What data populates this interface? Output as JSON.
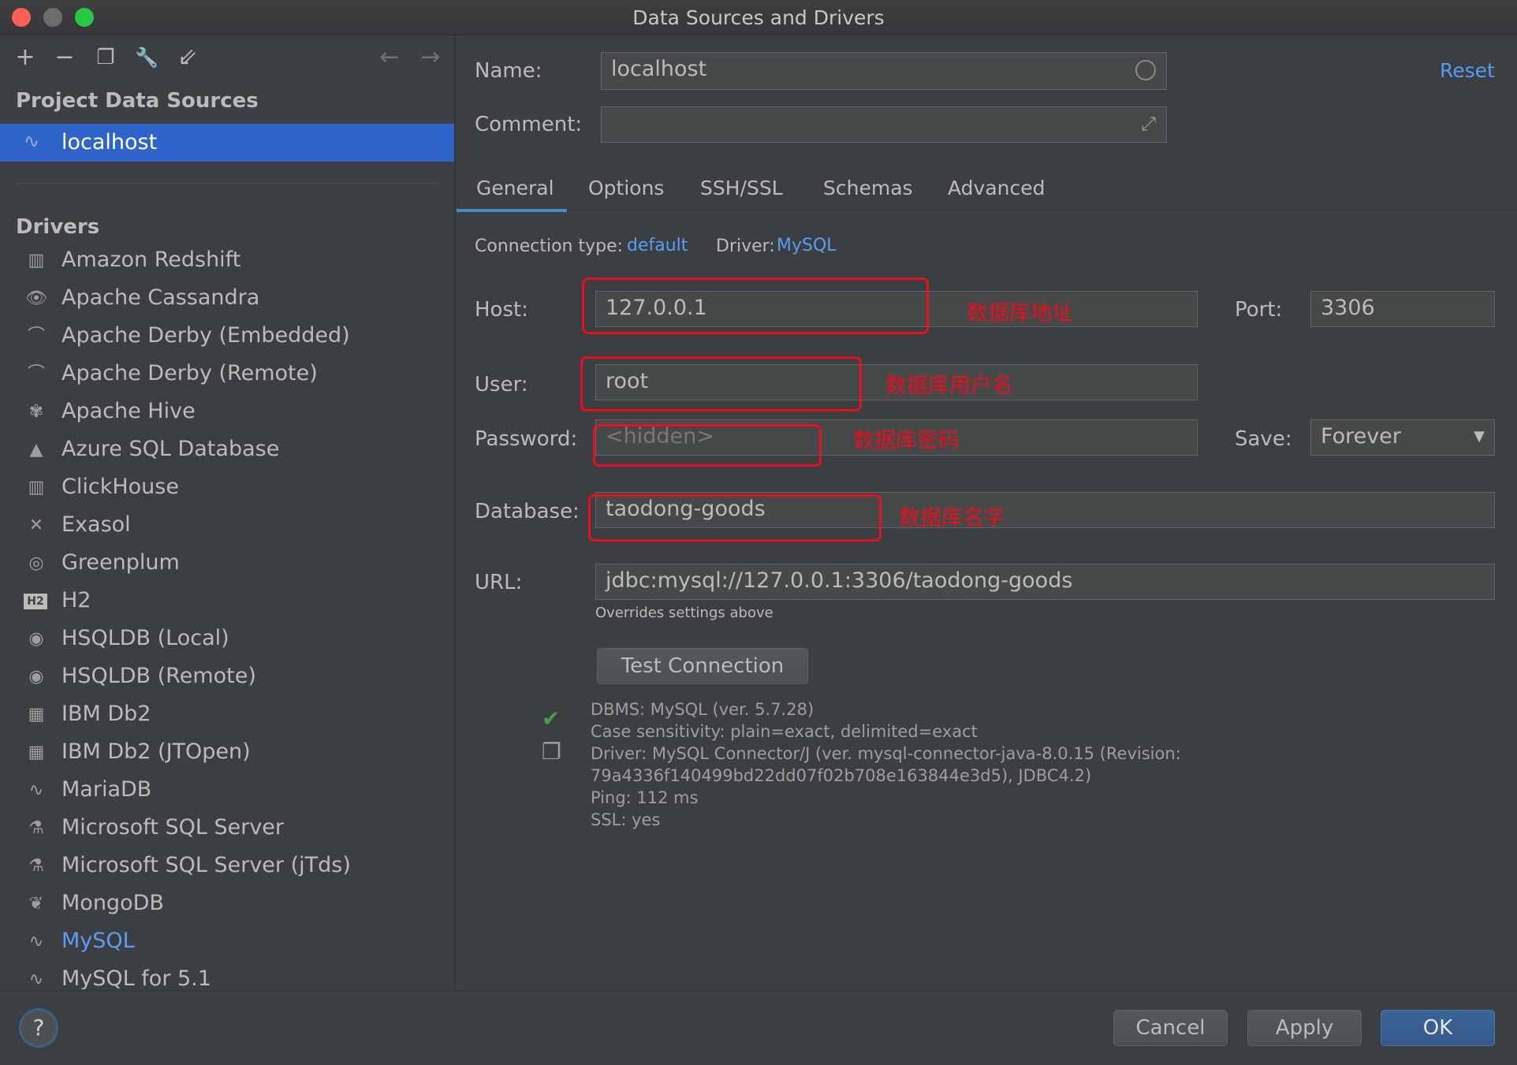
{
  "window": {
    "title": "Data Sources and Drivers"
  },
  "toolbar": {
    "add_icon": "+",
    "remove_icon": "−",
    "duplicate_icon": "❐",
    "settings_icon": "🔧",
    "import_icon": "⇙",
    "back_icon": "←",
    "forward_icon": "→"
  },
  "sidebar": {
    "project_title": "Project Data Sources",
    "data_sources": [
      {
        "label": "localhost"
      }
    ],
    "drivers_title": "Drivers",
    "drivers": [
      {
        "label": "Amazon Redshift",
        "icon": "▥"
      },
      {
        "label": "Apache Cassandra",
        "icon": "👁"
      },
      {
        "label": "Apache Derby (Embedded)",
        "icon": "⌒"
      },
      {
        "label": "Apache Derby (Remote)",
        "icon": "⌒"
      },
      {
        "label": "Apache Hive",
        "icon": "✾"
      },
      {
        "label": "Azure SQL Database",
        "icon": "▲"
      },
      {
        "label": "ClickHouse",
        "icon": "▥"
      },
      {
        "label": "Exasol",
        "icon": "✕"
      },
      {
        "label": "Greenplum",
        "icon": "◎"
      },
      {
        "label": "H2",
        "icon": "H2"
      },
      {
        "label": "HSQLDB (Local)",
        "icon": "◉"
      },
      {
        "label": "HSQLDB (Remote)",
        "icon": "◉"
      },
      {
        "label": "IBM Db2",
        "icon": "▦"
      },
      {
        "label": "IBM Db2 (JTOpen)",
        "icon": "▦"
      },
      {
        "label": "MariaDB",
        "icon": "∿"
      },
      {
        "label": "Microsoft SQL Server",
        "icon": "⚗"
      },
      {
        "label": "Microsoft SQL Server (jTds)",
        "icon": "⚗"
      },
      {
        "label": "MongoDB",
        "icon": "❦"
      },
      {
        "label": "MySQL",
        "icon": "∿"
      },
      {
        "label": "MySQL for 5.1",
        "icon": "∿"
      }
    ]
  },
  "form": {
    "name_label": "Name:",
    "name_value": "localhost",
    "comment_label": "Comment:",
    "comment_value": "",
    "reset_label": "Reset",
    "tabs": [
      "General",
      "Options",
      "SSH/SSL",
      "Schemas",
      "Advanced"
    ],
    "connection_type_label": "Connection type:",
    "connection_type_value": "default",
    "driver_label": "Driver:",
    "driver_value": "MySQL",
    "host_label": "Host:",
    "host_value": "127.0.0.1",
    "port_label": "Port:",
    "port_value": "3306",
    "user_label": "User:",
    "user_value": "root",
    "password_label": "Password:",
    "password_placeholder": "<hidden>",
    "save_label": "Save:",
    "save_value": "Forever",
    "database_label": "Database:",
    "database_value": "taodong-goods",
    "url_label": "URL:",
    "url_value": "jdbc:mysql://127.0.0.1:3306/taodong-goods",
    "url_hint": "Overrides settings above",
    "test_button": "Test Connection",
    "status_lines": [
      "DBMS: MySQL (ver. 5.7.28)",
      "Case sensitivity: plain=exact, delimited=exact",
      "Driver: MySQL Connector/J (ver. mysql-connector-java-8.0.15 (Revision:",
      "79a4336f140499bd22dd07f02b708e163844e3d5), JDBC4.2)",
      "Ping: 112 ms",
      "SSL: yes"
    ]
  },
  "annotations": {
    "host": "数据库地址",
    "user": "数据库用户名",
    "password": "数据库密码",
    "database": "数据库名字"
  },
  "footer": {
    "help_label": "?",
    "cancel_label": "Cancel",
    "apply_label": "Apply",
    "ok_label": "OK"
  },
  "colors": {
    "accent": "#589df6",
    "selection": "#2f65ca",
    "annotation": "#e8101e",
    "success": "#499c54"
  }
}
